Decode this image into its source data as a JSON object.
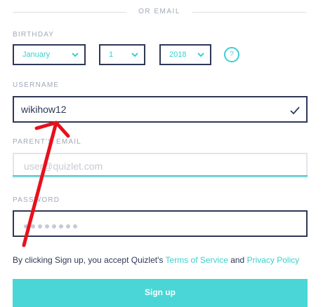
{
  "divider": {
    "text": "OR EMAIL"
  },
  "birthday": {
    "label": "BIRTHDAY",
    "month": "January",
    "day": "1",
    "year": "2018",
    "help_icon": "question-mark-icon",
    "help_text": "?"
  },
  "username": {
    "label": "USERNAME",
    "value": "wikihow12",
    "status_icon": "checkmark-icon"
  },
  "parent_email": {
    "label": "PARENT'S EMAIL",
    "placeholder": "user@quizlet.com"
  },
  "password": {
    "label": "PASSWORD",
    "masked_length": 8
  },
  "terms": {
    "prefix": "By clicking Sign up, you accept Quizlet's ",
    "tos": "Terms of Service",
    "and": " and ",
    "privacy": "Privacy Policy"
  },
  "signup_button": {
    "label": "Sign up"
  },
  "annotation": {
    "type": "red-arrow",
    "points_to": "username-field"
  },
  "colors": {
    "accent": "#3ccfcf",
    "text": "#2e3856",
    "muted": "#a1a8b9",
    "annotation": "#e8101c"
  }
}
